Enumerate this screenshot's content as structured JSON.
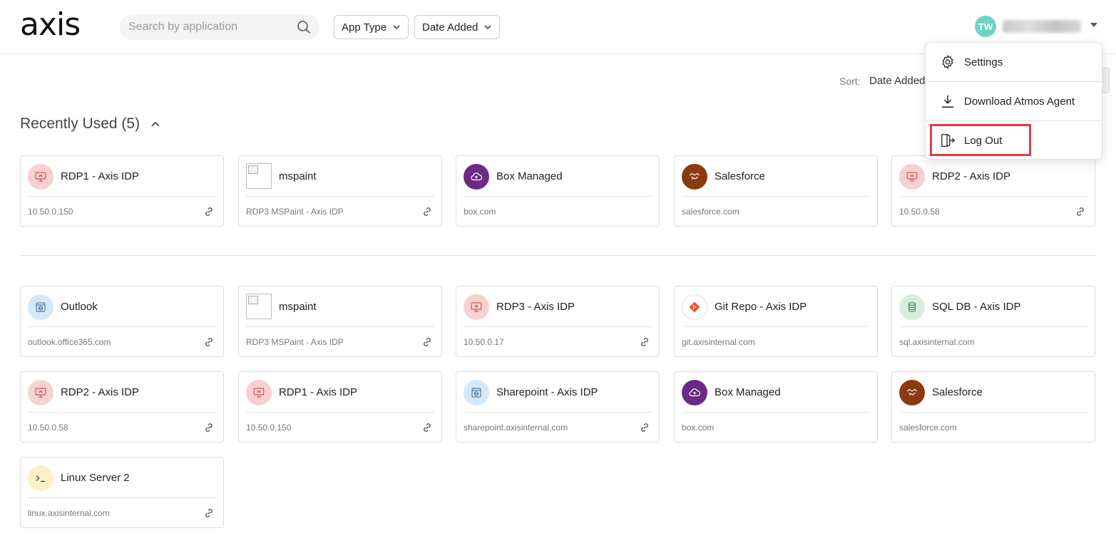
{
  "header": {
    "logo": "axis",
    "search_placeholder": "Search by application",
    "filters": [
      "App Type",
      "Date Added"
    ],
    "user_initials": "TW"
  },
  "sort": {
    "label": "Sort:",
    "value": "Date Added"
  },
  "section": {
    "title": "Recently Used (5)"
  },
  "user_menu": {
    "items": [
      "Settings",
      "Download Atmos Agent",
      "Log Out"
    ],
    "highlighted_item": "Log Out",
    "highlight_color": "#e53945"
  },
  "recently_used": [
    {
      "name": "RDP1 - Axis IDP",
      "host": "10.50.0.150",
      "icon": "monitor-icon",
      "bg": "#f7d0d0",
      "fg": "#c65b5b",
      "link": true
    },
    {
      "name": "mspaint",
      "host": "RDP3 MSPaint - Axis IDP",
      "icon": "broken-image-icon",
      "bg": "",
      "fg": "",
      "link": true
    },
    {
      "name": "Box Managed",
      "host": "box.com",
      "icon": "cloud-upload-icon",
      "bg": "#6b2a83",
      "fg": "#ffffff",
      "link": false
    },
    {
      "name": "Salesforce",
      "host": "salesforce.com",
      "icon": "handshake-icon",
      "bg": "#8a3a0c",
      "fg": "#ffffff",
      "link": false
    },
    {
      "name": "RDP2 - Axis IDP",
      "host": "10.50.0.58",
      "icon": "monitor-icon",
      "bg": "#f7d0d0",
      "fg": "#c65b5b",
      "link": true
    }
  ],
  "all_apps": [
    {
      "name": "Outlook",
      "host": "outlook.office365.com",
      "icon": "web-window-icon",
      "bg": "#d6e8f7",
      "fg": "#4a6f8f",
      "link": true
    },
    {
      "name": "mspaint",
      "host": "RDP3 MSPaint - Axis IDP",
      "icon": "broken-image-icon",
      "bg": "",
      "fg": "",
      "link": true
    },
    {
      "name": "RDP3 - Axis IDP",
      "host": "10.50.0.17",
      "icon": "monitor-icon",
      "bg": "#f7d0d0",
      "fg": "#c65b5b",
      "link": true
    },
    {
      "name": "Git Repo - Axis IDP",
      "host": "git.axisinternal.com",
      "icon": "git-icon",
      "bg": "#ffffff",
      "fg": "#e1532d",
      "link": false
    },
    {
      "name": "SQL DB - Axis IDP",
      "host": "sql.axisinternal.com",
      "icon": "database-icon",
      "bg": "#d6eedd",
      "fg": "#4b8d62",
      "link": false
    },
    {
      "name": "RDP2 - Axis IDP",
      "host": "10.50.0.58",
      "icon": "monitor-icon",
      "bg": "#f7d0d0",
      "fg": "#c65b5b",
      "link": true
    },
    {
      "name": "RDP1 - Axis IDP",
      "host": "10.50.0.150",
      "icon": "monitor-icon",
      "bg": "#f7d0d0",
      "fg": "#c65b5b",
      "link": true
    },
    {
      "name": "Sharepoint - Axis IDP",
      "host": "sharepoint.axisinternal.com",
      "icon": "web-window-icon",
      "bg": "#d6e8f7",
      "fg": "#4a6f8f",
      "link": true
    },
    {
      "name": "Box Managed",
      "host": "box.com",
      "icon": "cloud-upload-icon",
      "bg": "#6b2a83",
      "fg": "#ffffff",
      "link": false
    },
    {
      "name": "Salesforce",
      "host": "salesforce.com",
      "icon": "handshake-icon",
      "bg": "#8a3a0c",
      "fg": "#ffffff",
      "link": false
    },
    {
      "name": "Linux Server 2",
      "host": "linux.axisinternal.com",
      "icon": "terminal-icon",
      "bg": "#fdf0c8",
      "fg": "#333333",
      "link": true
    }
  ]
}
